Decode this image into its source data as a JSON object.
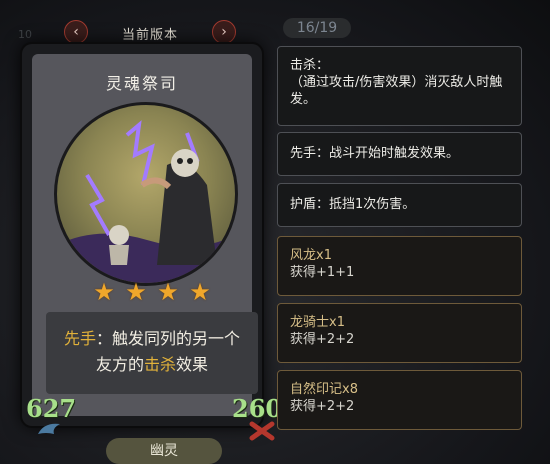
{
  "header": {
    "title": "当前版本",
    "prev_icon": "‹",
    "next_icon": "›",
    "page_counter": "16/19",
    "left_number": "10"
  },
  "card": {
    "name": "灵魂祭司",
    "stars": 4,
    "description": {
      "part1": "先手",
      "part2": "：触发同列的另一个友方的",
      "part3": "击杀",
      "part4": "效果"
    },
    "attack": "627",
    "health": "260",
    "tribe": "幽灵"
  },
  "keywords": [
    {
      "lines": [
        "击杀：",
        "（通过攻击/伤害效果）消灭敌人时触发。"
      ]
    },
    {
      "lines": [
        "先手：战斗开始时触发效果。"
      ]
    },
    {
      "lines": [
        "护盾：抵挡1次伤害。"
      ]
    }
  ],
  "cards": [
    {
      "name": "风龙x1",
      "effect": "获得+1+1"
    },
    {
      "name": "龙骑士x1",
      "effect": "获得+2+2"
    },
    {
      "name": "自然印记x8",
      "effect": "获得+2+2"
    }
  ],
  "colors": {
    "accent_gold": "#e2b23a",
    "stat_green": "#a8e08a",
    "border_gray": "#4e5055",
    "nav_red": "#a33a2f"
  }
}
